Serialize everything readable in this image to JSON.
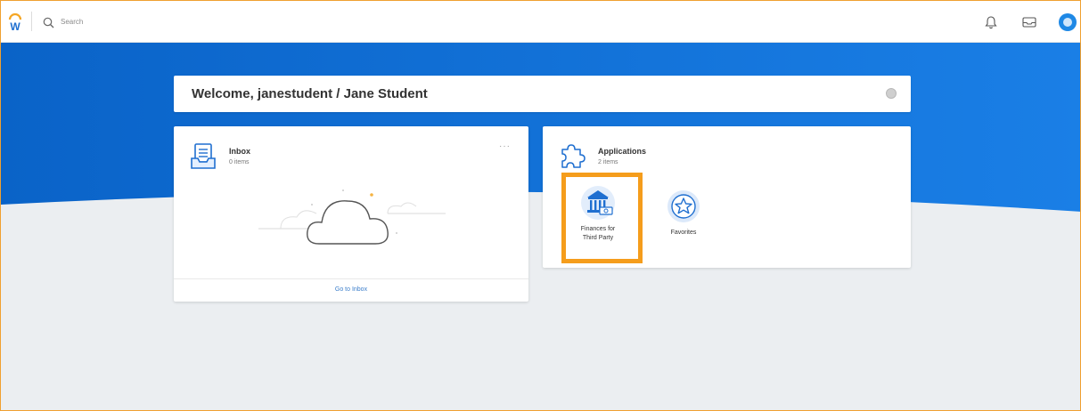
{
  "topbar": {
    "search_placeholder": "Search",
    "icons": [
      "workday-logo-icon",
      "search-icon",
      "bell-icon",
      "inbox-icon",
      "avatar"
    ]
  },
  "welcome": {
    "title": "Welcome, janestudent / Jane Student"
  },
  "inbox_card": {
    "title": "Inbox",
    "count": "0 items",
    "more": "···",
    "footer_link": "Go to Inbox"
  },
  "apps_card": {
    "title": "Applications",
    "count": "2 items",
    "apps": [
      {
        "line1": "Finances for",
        "line2": "Third Party",
        "icon": "bank-icon"
      },
      {
        "line1": "Favorites",
        "line2": "",
        "icon": "star-icon"
      }
    ]
  },
  "colors": {
    "hero_blue": "#0b6bd1",
    "highlight_orange": "#f59d1c",
    "link_blue": "#3b7ecb"
  }
}
